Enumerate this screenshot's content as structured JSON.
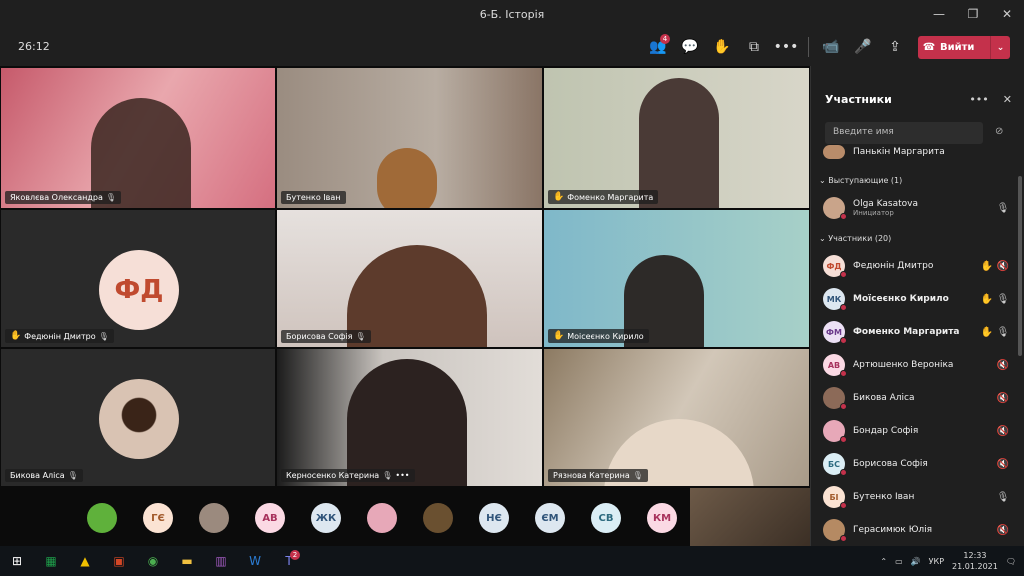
{
  "window": {
    "title": "6-Б. Історія"
  },
  "call": {
    "timer": "26:12",
    "chat_badge": "4",
    "leave_label": "Вийти"
  },
  "tiles": [
    {
      "name": "Яковлєва Олександра",
      "hand": false
    },
    {
      "name": "Бутенко Іван",
      "hand": false
    },
    {
      "name": "Фоменко Маргарита",
      "hand": true
    },
    {
      "name": "Федюнін Дмитро",
      "hand": true,
      "initials": "ФД"
    },
    {
      "name": "Борисова Софія",
      "hand": false
    },
    {
      "name": "Мoісеєнко Кирило",
      "hand": true
    },
    {
      "name": "Бикова Аліса",
      "hand": false
    },
    {
      "name": "Керносенко Катерина",
      "hand": false
    },
    {
      "name": "Рязнова Катерина",
      "hand": false
    }
  ],
  "bottom_avatars": [
    "",
    "ГЄ",
    "",
    "АВ",
    "ЖК",
    "",
    "",
    "НЄ",
    "ЄМ",
    "СВ",
    "КМ"
  ],
  "panel": {
    "title": "Участники",
    "search_placeholder": "Введите имя",
    "cut_name": "Панькін Маргарита",
    "presenters_header": "Выступающие (1)",
    "presenter": {
      "name": "Olga Kasatova",
      "role": "Инициатор"
    },
    "attendees_header": "Участники (20)",
    "attendees": [
      {
        "initials": "ФД",
        "name": "Федюнін Дмитро",
        "hand": true,
        "mic": "off",
        "bold": false,
        "color": "#f6dfd7",
        "fg": "#c04a2f"
      },
      {
        "initials": "МК",
        "name": "Моїсеєнко Кирило",
        "hand": true,
        "mic": "on",
        "bold": true,
        "color": "#dde7f0",
        "fg": "#31557a"
      },
      {
        "initials": "ФМ",
        "name": "Фоменко Маргарита",
        "hand": true,
        "mic": "on",
        "bold": true,
        "color": "#ece0f5",
        "fg": "#6b3a8c"
      },
      {
        "initials": "АВ",
        "name": "Артюшенко Вероніка",
        "hand": false,
        "mic": "off",
        "bold": false,
        "color": "#fbd9e4",
        "fg": "#a8325d"
      },
      {
        "initials": "",
        "name": "Бикова Аліса",
        "hand": false,
        "mic": "off",
        "bold": false,
        "color": "#8c6a58",
        "fg": "#fff"
      },
      {
        "initials": "",
        "name": "Бондар Софія",
        "hand": false,
        "mic": "off",
        "bold": false,
        "color": "#e7a8b8",
        "fg": "#fff"
      },
      {
        "initials": "БС",
        "name": "Борисова Софія",
        "hand": false,
        "mic": "off",
        "bold": false,
        "color": "#dbeef5",
        "fg": "#2d6b80"
      },
      {
        "initials": "БІ",
        "name": "Бутенко Іван",
        "hand": false,
        "mic": "on",
        "bold": false,
        "color": "#fbe3d3",
        "fg": "#a25a2b"
      },
      {
        "initials": "",
        "name": "Герасимюк Юлія",
        "hand": false,
        "mic": "off",
        "bold": false,
        "color": "#b58a63",
        "fg": "#fff"
      }
    ]
  },
  "taskbar": {
    "lang": "УКР",
    "time": "12:33",
    "date": "21.01.2021",
    "teams_badge": "2"
  }
}
